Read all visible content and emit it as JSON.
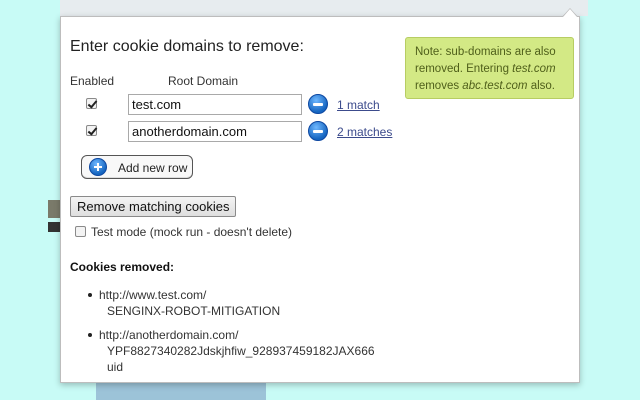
{
  "title": "Enter cookie domains to remove:",
  "note": {
    "prefix": "Note: sub-domains are also removed. Entering ",
    "example_domain": "test.com",
    "middle": " removes ",
    "example_subdomain": "abc.test.com",
    "suffix": " also."
  },
  "columns": {
    "enabled": "Enabled",
    "root_domain": "Root Domain"
  },
  "rows": [
    {
      "enabled": true,
      "domain": "test.com",
      "matches": "1 match"
    },
    {
      "enabled": true,
      "domain": "anotherdomain.com",
      "matches": "2 matches"
    }
  ],
  "add_row_label": "Add new row",
  "remove_button_label": "Remove matching cookies",
  "test_mode": {
    "checked": false,
    "label": "Test mode (mock run - doesn't delete)"
  },
  "cookies_removed_title": "Cookies removed:",
  "removed": [
    {
      "url": "http://www.test.com/",
      "names": [
        "SENGINX-ROBOT-MITIGATION"
      ]
    },
    {
      "url": "http://anotherdomain.com/",
      "names": [
        "YPF8827340282Jdskjhfiw_928937459182JAX666",
        "uid"
      ]
    }
  ],
  "colors": {
    "note_bg": "#d3e985",
    "accent": "#1565c0",
    "page_bg": "#c8fbf6"
  },
  "icons": {
    "remove_row": "minus-circle-icon",
    "add_row": "plus-circle-icon"
  }
}
